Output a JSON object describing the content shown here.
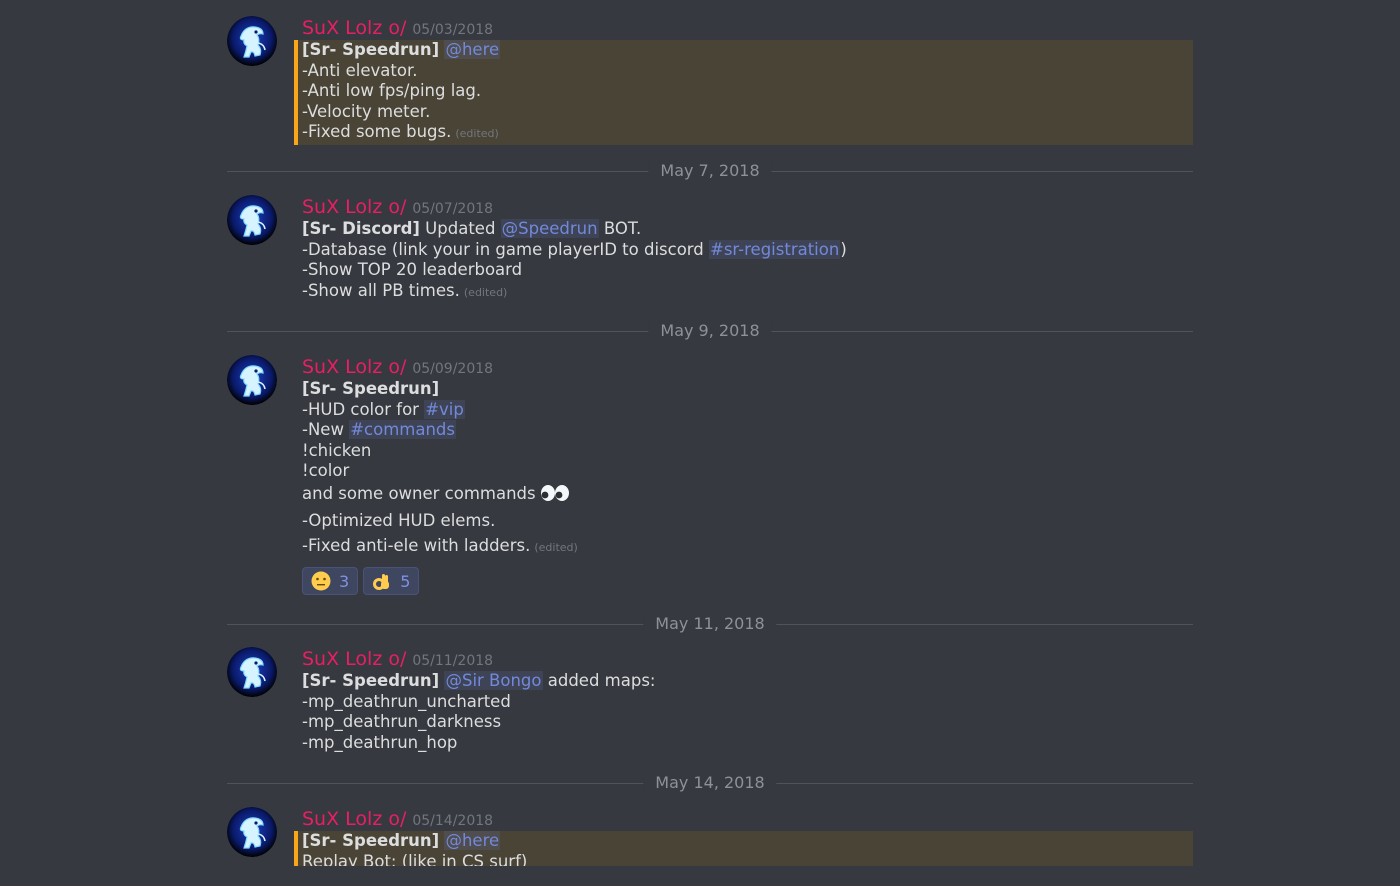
{
  "colors": {
    "background": "#36393f",
    "author": "#e91e63",
    "mention": "#7289da",
    "highlight_bar": "#faa61a",
    "highlight_bg": "#4a4437"
  },
  "messages": [
    {
      "author": "SuX Lolz o/",
      "timestamp": "05/03/2018",
      "highlighted": true,
      "lines": [
        [
          {
            "t": "bold",
            "v": "[Sr- Speedrun]"
          },
          {
            "t": "text",
            "v": " "
          },
          {
            "t": "mention",
            "v": "@here"
          }
        ],
        [
          {
            "t": "text",
            "v": "-Anti elevator."
          }
        ],
        [
          {
            "t": "text",
            "v": "-Anti low fps/ping lag."
          }
        ],
        [
          {
            "t": "text",
            "v": "-Velocity meter."
          }
        ],
        [
          {
            "t": "text",
            "v": "-Fixed some bugs."
          },
          {
            "t": "edited",
            "v": "(edited)"
          }
        ]
      ]
    },
    {
      "divider": "May 7, 2018",
      "author": "SuX Lolz o/",
      "timestamp": "05/07/2018",
      "lines": [
        [
          {
            "t": "bold",
            "v": "[Sr- Discord]"
          },
          {
            "t": "text",
            "v": " Updated "
          },
          {
            "t": "mention",
            "v": "@Speedrun"
          },
          {
            "t": "text",
            "v": " BOT."
          }
        ],
        [
          {
            "t": "text",
            "v": "-Database (link your in game playerID to discord "
          },
          {
            "t": "mention",
            "v": "#sr-registration"
          },
          {
            "t": "text",
            "v": ")"
          }
        ],
        [
          {
            "t": "text",
            "v": "-Show TOP 20 leaderboard"
          }
        ],
        [
          {
            "t": "text",
            "v": "-Show all PB times."
          },
          {
            "t": "edited",
            "v": "(edited)"
          }
        ]
      ]
    },
    {
      "divider": "May 9, 2018",
      "author": "SuX Lolz o/",
      "timestamp": "05/09/2018",
      "lines": [
        [
          {
            "t": "bold",
            "v": "[Sr- Speedrun]"
          }
        ],
        [
          {
            "t": "text",
            "v": "-HUD color for "
          },
          {
            "t": "mention",
            "v": "#vip"
          }
        ],
        [
          {
            "t": "text",
            "v": "-New "
          },
          {
            "t": "mention",
            "v": "#commands"
          }
        ],
        [
          {
            "t": "text",
            "v": "!chicken"
          }
        ],
        [
          {
            "t": "text",
            "v": "!color"
          }
        ],
        [
          {
            "t": "text",
            "v": "and some owner commands"
          },
          {
            "t": "eyes",
            "v": "eyes-emoji"
          }
        ],
        [
          {
            "t": "text",
            "v": "-Optimized HUD elems."
          }
        ],
        [
          {
            "t": "text",
            "v": "-Fixed anti-ele with ladders."
          },
          {
            "t": "edited",
            "v": "(edited)"
          }
        ]
      ],
      "reactions": [
        {
          "emoji": "neutral-face-emoji",
          "count": "3"
        },
        {
          "emoji": "ok-hand-emoji",
          "count": "5"
        }
      ]
    },
    {
      "divider": "May 11, 2018",
      "author": "SuX Lolz o/",
      "timestamp": "05/11/2018",
      "lines": [
        [
          {
            "t": "bold",
            "v": "[Sr- Speedrun]"
          },
          {
            "t": "text",
            "v": " "
          },
          {
            "t": "mention",
            "v": "@Sir Bongo"
          },
          {
            "t": "text",
            "v": " added maps:"
          }
        ],
        [
          {
            "t": "text",
            "v": "-mp_deathrun_uncharted"
          }
        ],
        [
          {
            "t": "text",
            "v": "-mp_deathrun_darkness"
          }
        ],
        [
          {
            "t": "text",
            "v": "-mp_deathrun_hop"
          }
        ]
      ]
    },
    {
      "divider": "May 14, 2018",
      "author": "SuX Lolz o/",
      "timestamp": "05/14/2018",
      "highlighted": true,
      "lines": [
        [
          {
            "t": "bold",
            "v": "[Sr- Speedrun]"
          },
          {
            "t": "text",
            "v": " "
          },
          {
            "t": "mention",
            "v": "@here"
          }
        ],
        [
          {
            "t": "text",
            "v": "Replay Bot: (like in CS surf)"
          }
        ]
      ]
    }
  ]
}
